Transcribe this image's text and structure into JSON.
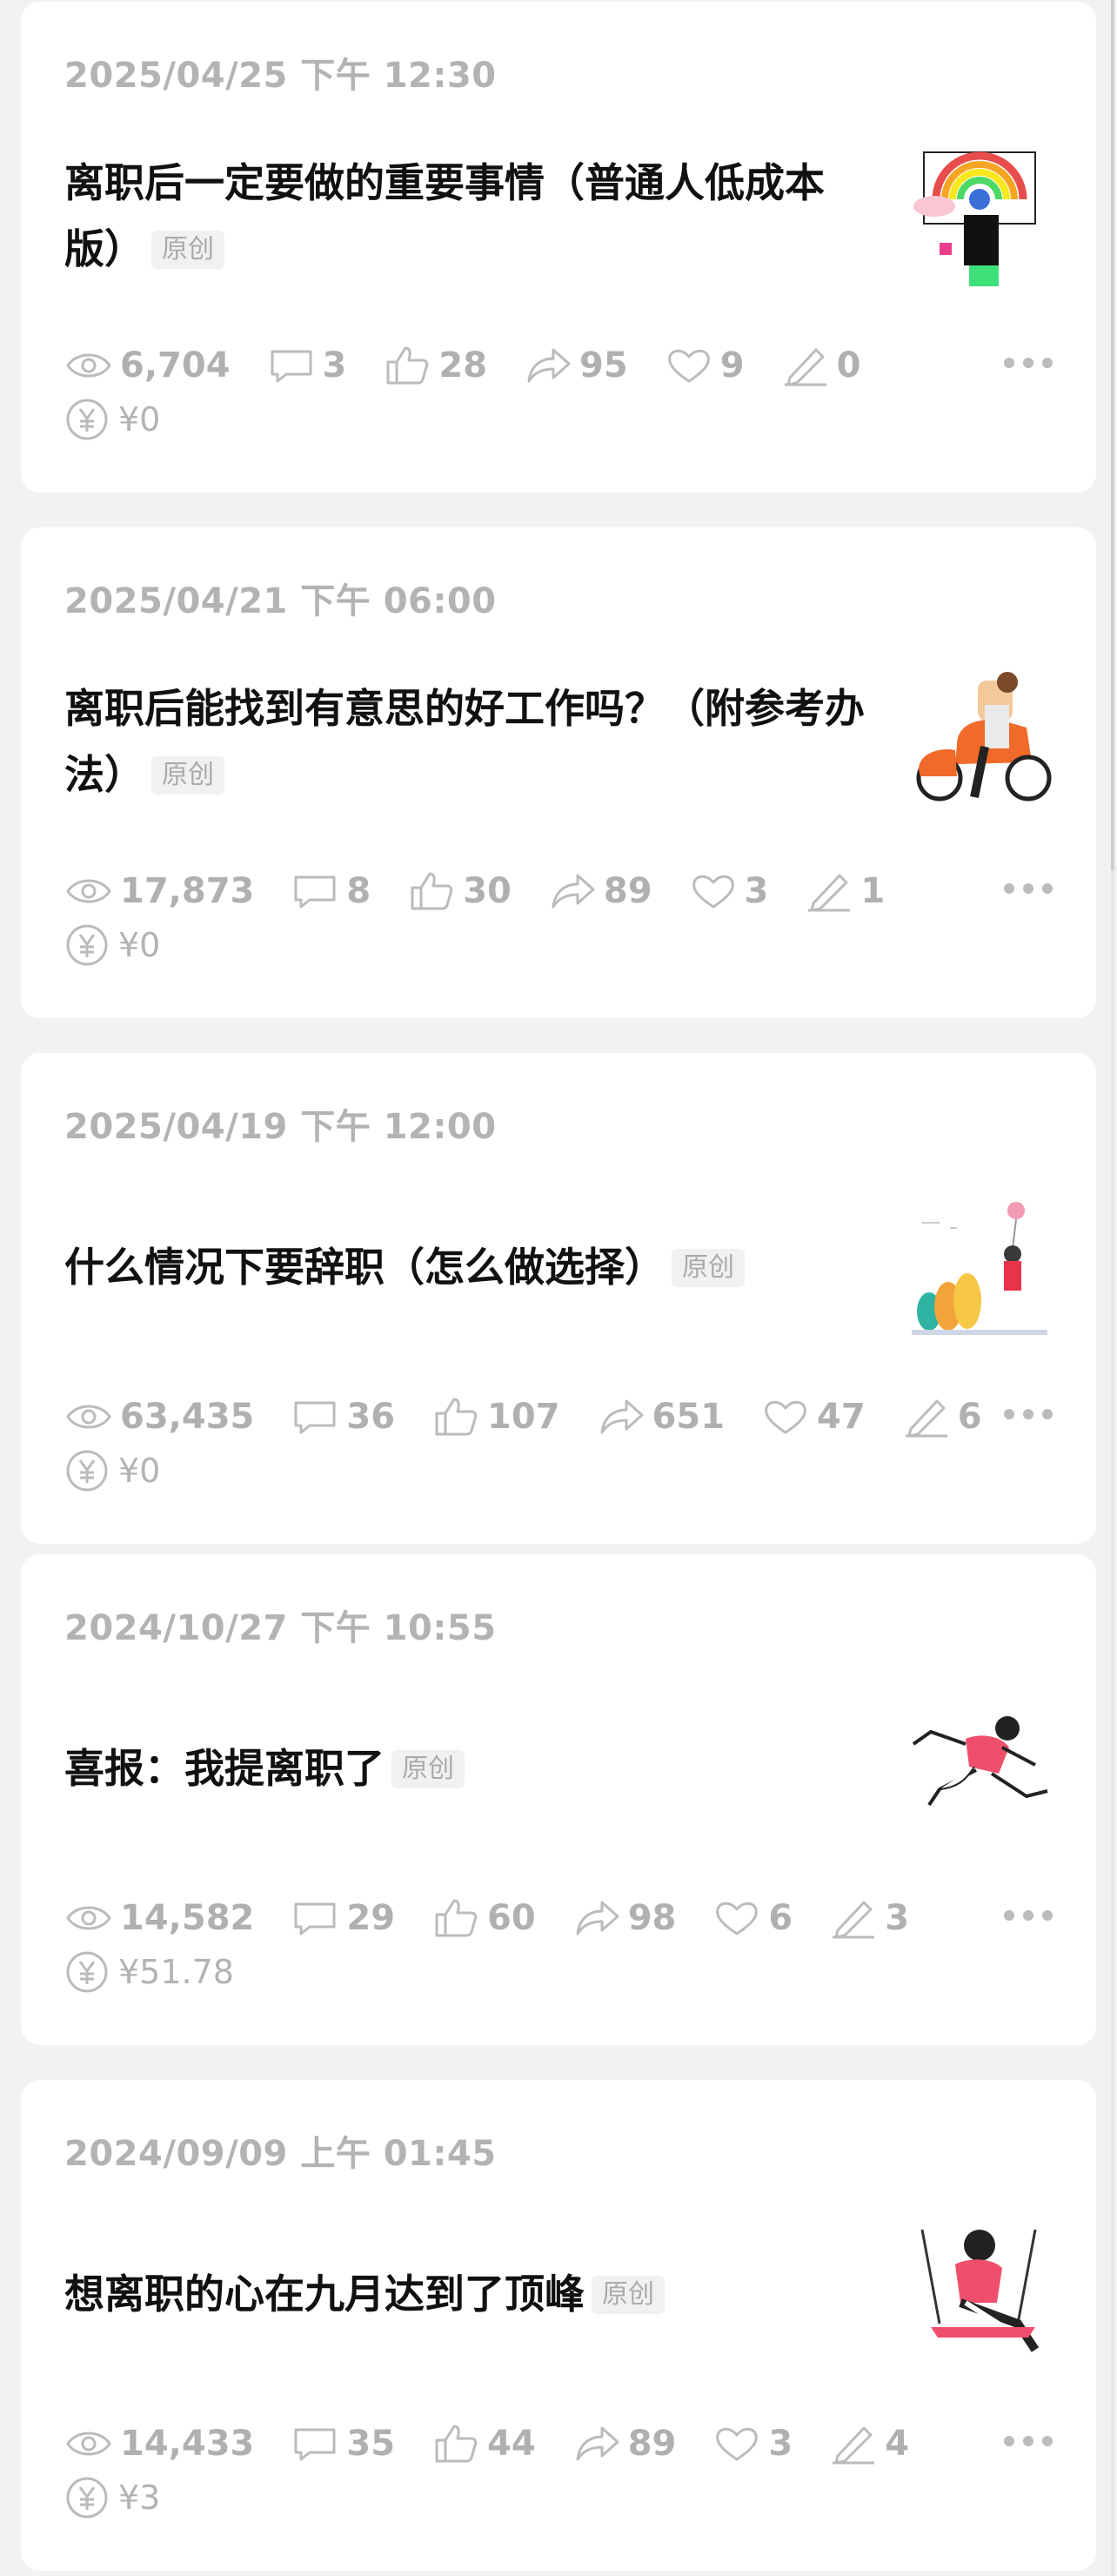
{
  "colors": {
    "background": "#f2f2f2",
    "card": "#ffffff",
    "muted": "#b3b3b3",
    "title": "#111111"
  },
  "posts": [
    {
      "date": "2025/04/25 下午 12:30",
      "title": "离职后一定要做的重要事情（普通人低成本版）",
      "tag": "原创",
      "stats": {
        "views": "6,704",
        "comments": "3",
        "likes": "28",
        "shares": "95",
        "favorites": "9",
        "edits": "0"
      },
      "income": "¥0",
      "thumb_icon": "rainbow-illustration-icon"
    },
    {
      "date": "2025/04/21 下午 06:00",
      "title": "离职后能找到有意思的好工作吗？（附参考办法）",
      "tag": "原创",
      "stats": {
        "views": "17,873",
        "comments": "8",
        "likes": "30",
        "shares": "89",
        "favorites": "3",
        "edits": "1"
      },
      "income": "¥0",
      "thumb_icon": "scooter-illustration-icon"
    },
    {
      "date": "2025/04/19 下午 12:00",
      "title": "什么情况下要辞职（怎么做选择）",
      "tag": "原创",
      "stats": {
        "views": "63,435",
        "comments": "36",
        "likes": "107",
        "shares": "651",
        "favorites": "47",
        "edits": "6"
      },
      "income": "¥0",
      "thumb_icon": "trees-illustration-icon"
    },
    {
      "date": "2024/10/27 下午 10:55",
      "title": "喜报：我提离职了",
      "tag": "原创",
      "stats": {
        "views": "14,582",
        "comments": "29",
        "likes": "60",
        "shares": "98",
        "favorites": "6",
        "edits": "3"
      },
      "income": "¥51.78",
      "thumb_icon": "running-person-illustration-icon"
    },
    {
      "date": "2024/09/09 上午 01:45",
      "title": "想离职的心在九月达到了顶峰",
      "tag": "原创",
      "stats": {
        "views": "14,433",
        "comments": "35",
        "likes": "44",
        "shares": "89",
        "favorites": "3",
        "edits": "4"
      },
      "income": "¥3",
      "thumb_icon": "swing-illustration-icon"
    }
  ]
}
